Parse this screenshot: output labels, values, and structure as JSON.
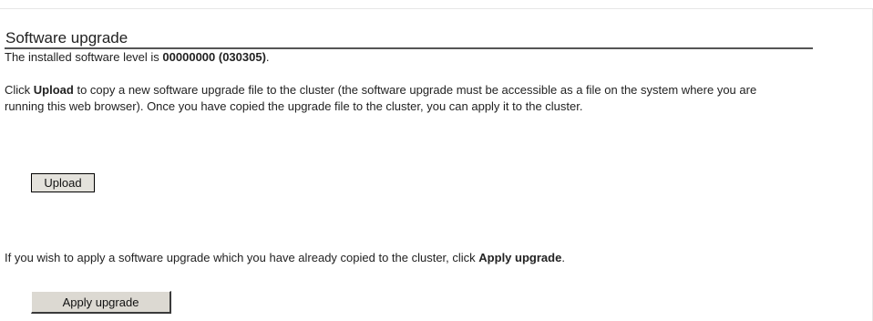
{
  "section": {
    "title": "Software upgrade"
  },
  "installed": {
    "prefix": "The installed software level is ",
    "level": "00000000 (030305)",
    "suffix": "."
  },
  "upload_info": {
    "prefix": "Click ",
    "action": "Upload",
    "line_rest": " to copy a new software upgrade file to the cluster (the software upgrade must be accessible as a file on the system where you are running this web browser). Once you have copied the upgrade file to the cluster, you can apply it to the cluster."
  },
  "buttons": {
    "upload_label": "Upload",
    "apply_label": "Apply upgrade"
  },
  "apply_info": {
    "prefix": "If you wish to apply a software upgrade which you have already copied to the cluster, click ",
    "action": "Apply upgrade",
    "suffix": "."
  }
}
